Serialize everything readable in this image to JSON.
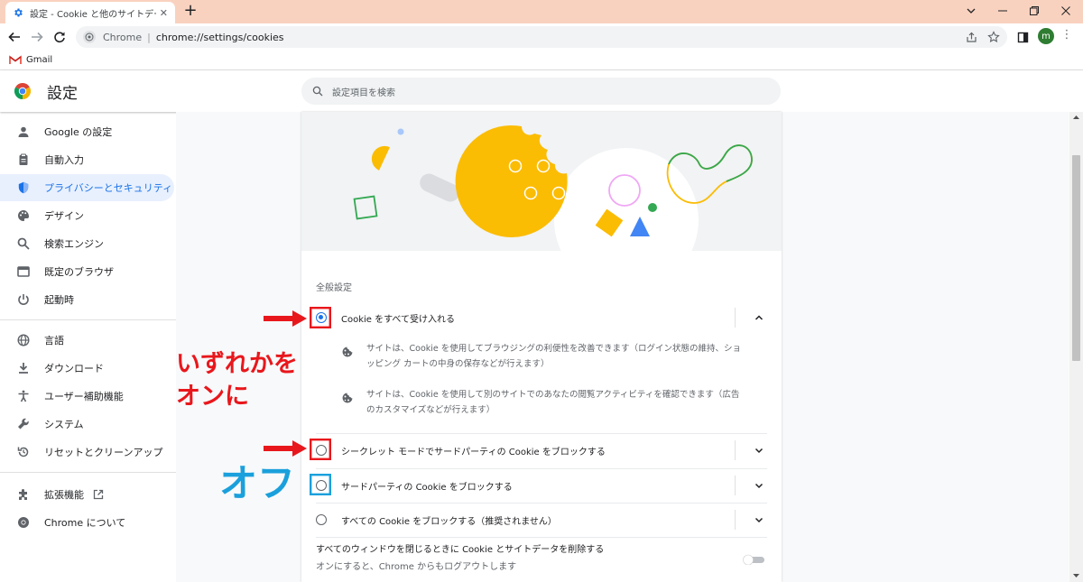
{
  "browser": {
    "tab_title": "設定 - Cookie と他のサイトデータ",
    "omnibox_label": "Chrome",
    "omnibox_sep": "|",
    "url": "chrome://settings/cookies",
    "bookmark_gmail": "Gmail",
    "avatar_letter": "m"
  },
  "header": {
    "title": "設定",
    "search_placeholder": "設定項目を検索"
  },
  "sidebar": {
    "items": [
      {
        "label": "Google の設定",
        "icon": "person-icon"
      },
      {
        "label": "自動入力",
        "icon": "clipboard-icon"
      },
      {
        "label": "プライバシーとセキュリティ",
        "icon": "shield-icon",
        "active": true
      },
      {
        "label": "デザイン",
        "icon": "palette-icon"
      },
      {
        "label": "検索エンジン",
        "icon": "search-icon"
      },
      {
        "label": "既定のブラウザ",
        "icon": "browser-icon"
      },
      {
        "label": "起動時",
        "icon": "power-icon"
      },
      {
        "label": "言語",
        "icon": "globe-icon"
      },
      {
        "label": "ダウンロード",
        "icon": "download-icon"
      },
      {
        "label": "ユーザー補助機能",
        "icon": "accessibility-icon"
      },
      {
        "label": "システム",
        "icon": "wrench-icon"
      },
      {
        "label": "リセットとクリーンアップ",
        "icon": "reset-icon"
      },
      {
        "label": "拡張機能",
        "icon": "puzzle-icon"
      },
      {
        "label": "Chrome について",
        "icon": "chrome-icon"
      }
    ]
  },
  "content": {
    "section_title": "全般設定",
    "options": [
      {
        "label": "Cookie をすべて受け入れる",
        "selected": true,
        "expanded": true
      },
      {
        "label": "シークレット モードでサードパーティの Cookie をブロックする",
        "selected": false
      },
      {
        "label": "サードパーティの Cookie をブロックする",
        "selected": false
      },
      {
        "label": "すべての Cookie をブロックする（推奨されません）",
        "selected": false
      }
    ],
    "details": [
      {
        "line1": "サイトは、Cookie を使用してブラウジングの利便性を改善できます（ログイン状態の維持、ショ",
        "line2": "ッピング カートの中身の保存などが行えます）"
      },
      {
        "line1": "サイトは、Cookie を使用して別のサイトでのあなたの閲覧アクティビティを確認できます（広告",
        "line2": "のカスタマイズなどが行えます）"
      }
    ],
    "clear_on_exit": {
      "title": "すべてのウィンドウを閉じるときに Cookie とサイトデータを削除する",
      "subtitle": "オンにすると、Chrome からもログアウトします",
      "enabled": false
    }
  },
  "annotations": {
    "on_text_1": "いずれかを",
    "on_text_2": "オンに",
    "off_text": "オフ",
    "red": "#e8171c",
    "blue": "#1aa0dc"
  },
  "colors": {
    "accent": "#1a73e8",
    "titlebar": "#f9d2bf"
  }
}
